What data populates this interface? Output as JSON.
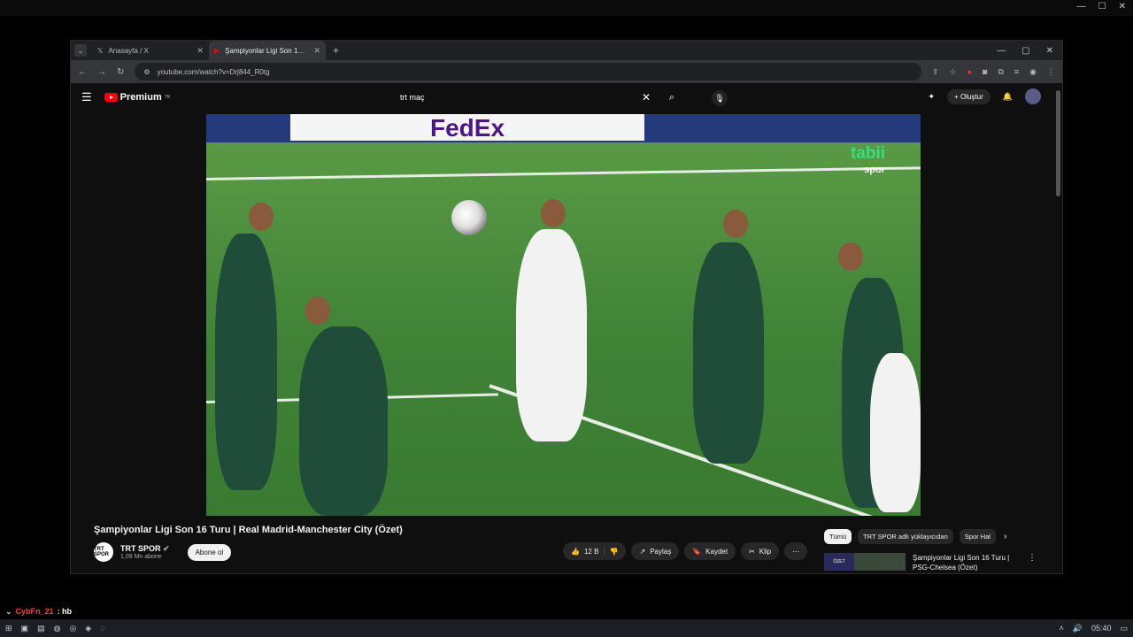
{
  "os": {
    "min": "—",
    "max": "☐",
    "close": "✕"
  },
  "browser": {
    "tabs": [
      {
        "title": "Anasayfa / X",
        "icon": "x-logo-icon"
      },
      {
        "title": "Şampiyonlar Ligi Son 16 Turu | R",
        "icon": "youtube-icon"
      }
    ],
    "url": "youtube.com/watch?v=Drj844_R0tg",
    "win_min": "—",
    "win_max": "▢",
    "win_close": "✕"
  },
  "youtube": {
    "logo_text": "Premium",
    "logo_sup": "TR",
    "search_query": "trt maç",
    "create_label": "Oluştur"
  },
  "video": {
    "sponsor": "FedEx",
    "watermark": "tabii",
    "watermark_sub": "spor",
    "title": "Şampiyonlar Ligi Son 16 Turu | Real Madrid-Manchester City (Özet)"
  },
  "channel": {
    "logo_text": "TRT SPOR",
    "name": "TRT SPOR",
    "subs": "1,09 Mn abone",
    "subscribe_label": "Abone ol"
  },
  "actions": {
    "likes": "12 B",
    "share": "Paylaş",
    "save": "Kaydet",
    "clip": "Klip"
  },
  "chips": [
    "Tümü",
    "TRT SPOR adlı yüklayıcıdan",
    "Spor Hal"
  ],
  "recommended": {
    "title": "Şampiyonlar Ligi Son 16 Turu | PSG-Chelsea (Özet)",
    "thumb_label": "ÖZET"
  },
  "chat": {
    "user": "CybFn_21",
    "message": ": hb"
  },
  "taskbar": {
    "time": "05:40"
  }
}
